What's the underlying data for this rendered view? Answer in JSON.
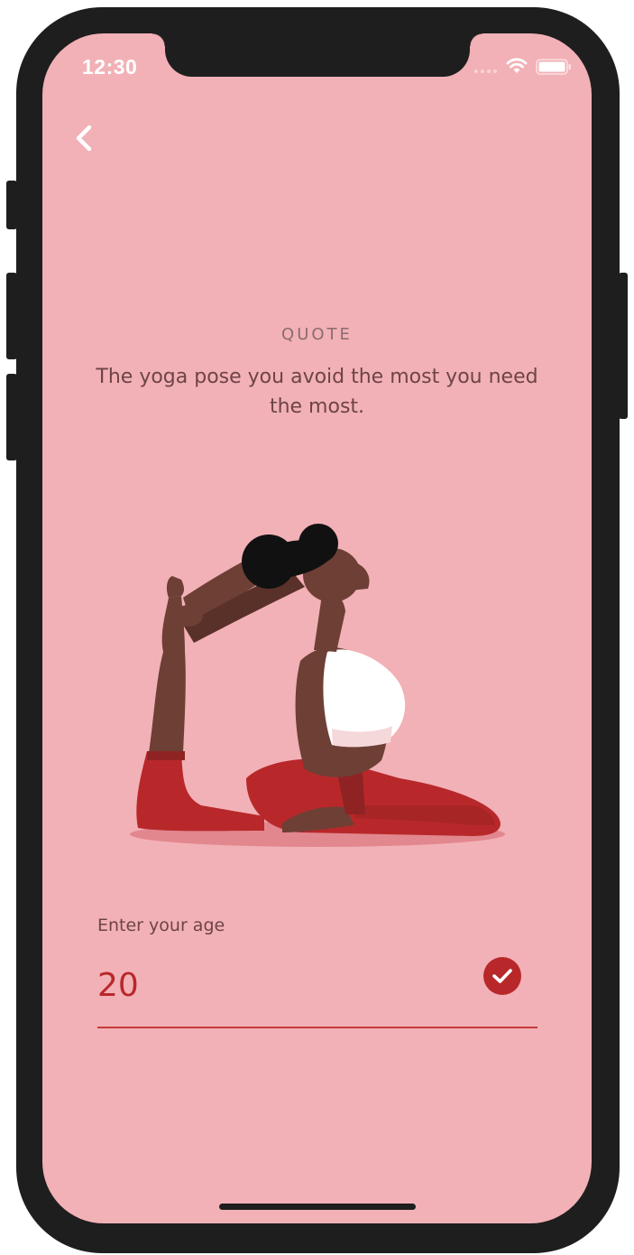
{
  "status_bar": {
    "time": "12:30",
    "signal_icon": "cellular-signal-icon",
    "wifi_icon": "wifi-icon",
    "battery_icon": "battery-icon"
  },
  "nav": {
    "back_icon": "chevron-left-icon"
  },
  "quote": {
    "heading": "QUOTE",
    "text": "The yoga pose you avoid the most you need the most."
  },
  "illustration": {
    "subject": "woman-in-yoga-pose"
  },
  "age_form": {
    "label": "Enter your age",
    "value": "20",
    "confirm_icon": "checkmark-icon"
  },
  "colors": {
    "background": "#f2b1b6",
    "accent": "#b8282a",
    "text": "#6d4447",
    "heading": "#8a6c6f"
  }
}
